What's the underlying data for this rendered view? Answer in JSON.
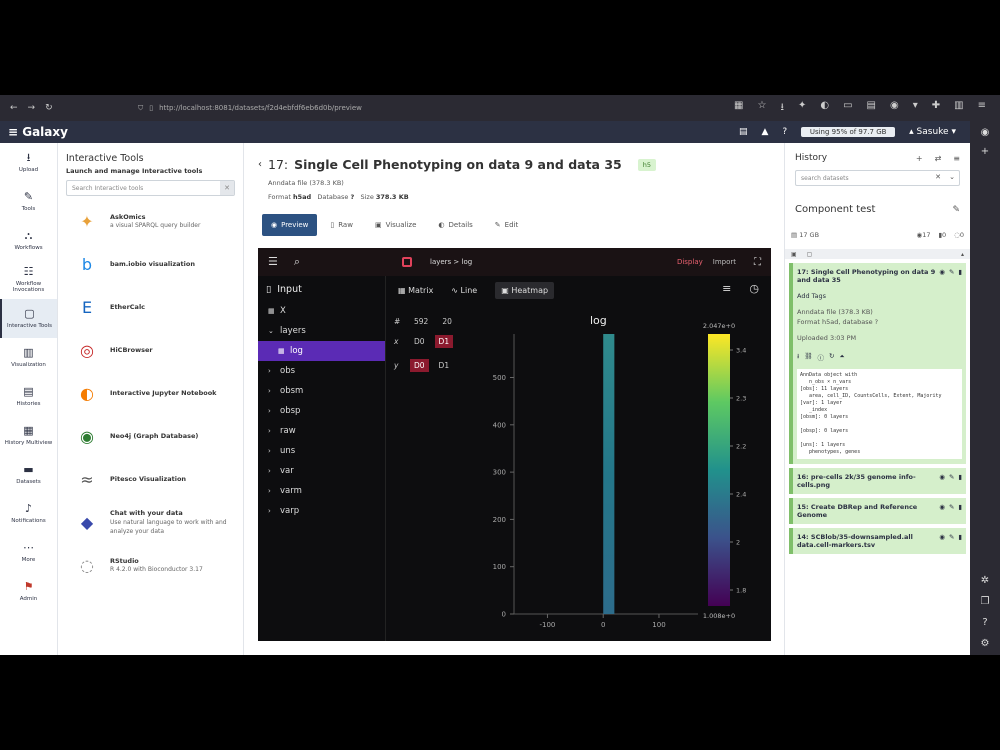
{
  "browser": {
    "url": "http://localhost:8081/datasets/f2d4ebfdf6eb6d0b/preview"
  },
  "galaxy": {
    "brand": "Galaxy",
    "usage": "Using 95% of 97.7 GB",
    "user": "Sasuke"
  },
  "activity": [
    {
      "label": "Upload",
      "icon": "⭳",
      "name": "upload"
    },
    {
      "label": "Tools",
      "icon": "✎",
      "name": "tools"
    },
    {
      "label": "Workflows",
      "icon": "⛬",
      "name": "workflows"
    },
    {
      "label": "Workflow Invocations",
      "icon": "☷",
      "name": "workflow-invocations"
    },
    {
      "label": "Interactive Tools",
      "icon": "▢",
      "name": "interactive-tools"
    },
    {
      "label": "Visualization",
      "icon": "▥",
      "name": "visualization"
    },
    {
      "label": "Histories",
      "icon": "▤",
      "name": "histories"
    },
    {
      "label": "History Multiview",
      "icon": "▦",
      "name": "history-multiview"
    },
    {
      "label": "Datasets",
      "icon": "▬",
      "name": "datasets"
    },
    {
      "label": "Notifications",
      "icon": "♪",
      "name": "notifications"
    },
    {
      "label": "More",
      "icon": "⋯",
      "name": "more"
    },
    {
      "label": "Admin",
      "icon": "⚑",
      "name": "admin"
    }
  ],
  "toolpanel": {
    "title": "Interactive Tools",
    "subtitle": "Launch and manage Interactive tools",
    "search_placeholder": "Search Interactive tools",
    "tools": [
      {
        "name": "AskOmics",
        "desc": "a visual SPARQL query builder",
        "icon": "✦",
        "color": "#e8a13a"
      },
      {
        "name": "bam.iobio visualization",
        "desc": "",
        "icon": "b",
        "color": "#1e88e5"
      },
      {
        "name": "EtherCalc",
        "desc": "",
        "icon": "E",
        "color": "#1565c0"
      },
      {
        "name": "HiCBrowser",
        "desc": "",
        "icon": "◎",
        "color": "#c62828"
      },
      {
        "name": "Interactive Jupyter Notebook",
        "desc": "",
        "icon": "◐",
        "color": "#f57c00"
      },
      {
        "name": "Neo4j (Graph Database)",
        "desc": "",
        "icon": "◉",
        "color": "#2e7d32"
      },
      {
        "name": "Pitesco Visualization",
        "desc": "",
        "icon": "≈",
        "color": "#555"
      },
      {
        "name": "Chat with your data",
        "desc": "Use natural language to work with and analyze your data",
        "icon": "◆",
        "color": "#3949ab"
      },
      {
        "name": "RStudio",
        "desc": "R 4.2.0 with Bioconductor 3.17",
        "icon": "◌",
        "color": "#888"
      }
    ]
  },
  "dataset": {
    "hid": "17:",
    "name": "Single Cell Phenotyping on data 9 and data 35",
    "tag": "h5",
    "info": "Anndata file (378.3 KB)",
    "format_label": "Format",
    "format": "h5ad",
    "database_label": "Database",
    "database": "?",
    "size_label": "Size",
    "size": "378.3 KB",
    "tabs": [
      "Preview",
      "Raw",
      "Visualize",
      "Details",
      "Edit"
    ]
  },
  "viewer": {
    "breadcrumb": "layers  >  log",
    "display": "Display",
    "import": "Import",
    "root": "Input",
    "tree": [
      {
        "label": "X",
        "icon": "▦",
        "indent": 1
      },
      {
        "label": "layers",
        "icon": "⌄",
        "indent": 1
      },
      {
        "label": "log",
        "icon": "▦",
        "indent": 2,
        "selected": true
      },
      {
        "label": "obs",
        "icon": "›",
        "indent": 1
      },
      {
        "label": "obsm",
        "icon": "›",
        "indent": 1
      },
      {
        "label": "obsp",
        "icon": "›",
        "indent": 1
      },
      {
        "label": "raw",
        "icon": "›",
        "indent": 1
      },
      {
        "label": "uns",
        "icon": "›",
        "indent": 1
      },
      {
        "label": "var",
        "icon": "›",
        "indent": 1
      },
      {
        "label": "varm",
        "icon": "›",
        "indent": 1
      },
      {
        "label": "varp",
        "icon": "›",
        "indent": 1
      }
    ],
    "subtabs": [
      "Matrix",
      "Line",
      "Heatmap"
    ],
    "dims": {
      "hash": "#",
      "a": "592",
      "b": "20"
    },
    "xsel": {
      "lab": "x",
      "a": "D0",
      "b": "D1"
    },
    "ysel": {
      "lab": "y",
      "a": "D0",
      "b": "D1"
    }
  },
  "chart_data": {
    "type": "heatmap",
    "title": "log",
    "x_ticks": [
      -100,
      0,
      100
    ],
    "y_ticks": [
      0,
      100,
      200,
      300,
      400,
      500
    ],
    "xlim": [
      -160,
      170
    ],
    "ylim": [
      0,
      592
    ],
    "data_x_range": [
      0,
      20
    ],
    "data_y_range": [
      0,
      592
    ],
    "colorbar": {
      "max_label": "2.047e+0",
      "min_label": "1.008e+0",
      "ticks": [
        "3.4",
        "2.3",
        "2.2",
        "2.4",
        "2",
        "1.8"
      ],
      "colors": [
        "#fde725",
        "#5ec962",
        "#21918c",
        "#3b528b",
        "#440154"
      ]
    }
  },
  "history": {
    "title": "History",
    "search_placeholder": "search datasets",
    "name": "Component test",
    "size": "17 GB",
    "counts": {
      "shown": "17",
      "deleted": "0",
      "hidden": "0"
    },
    "items": [
      {
        "title": "17: Single Cell Phenotyping on data 9 and data 35",
        "tags": "Add Tags",
        "info": "Anndata file (378.3 KB)",
        "format_line": "Format h5ad, database ?",
        "uploaded": "Uploaded 3:03 PM",
        "peek": [
          "AnnData object with",
          "   n_obs × n_vars",
          "[obs]: 11 layers",
          "   area, cell_ID, CountsCells, Extent, Majority",
          "[var]: 1 layer",
          "   _index",
          "[obsm]: 0 layers",
          "",
          "[obsp]: 0 layers",
          "",
          "[uns]: 1 layers",
          "   phenotypes, genes"
        ]
      },
      {
        "title": "16: pre-cells 2k/35 genome info-cells.png"
      },
      {
        "title": "15: Create DBRep and Reference Genome"
      },
      {
        "title": "14: SCBlob/35-downsampled.all data.cell-markers.tsv"
      }
    ]
  }
}
